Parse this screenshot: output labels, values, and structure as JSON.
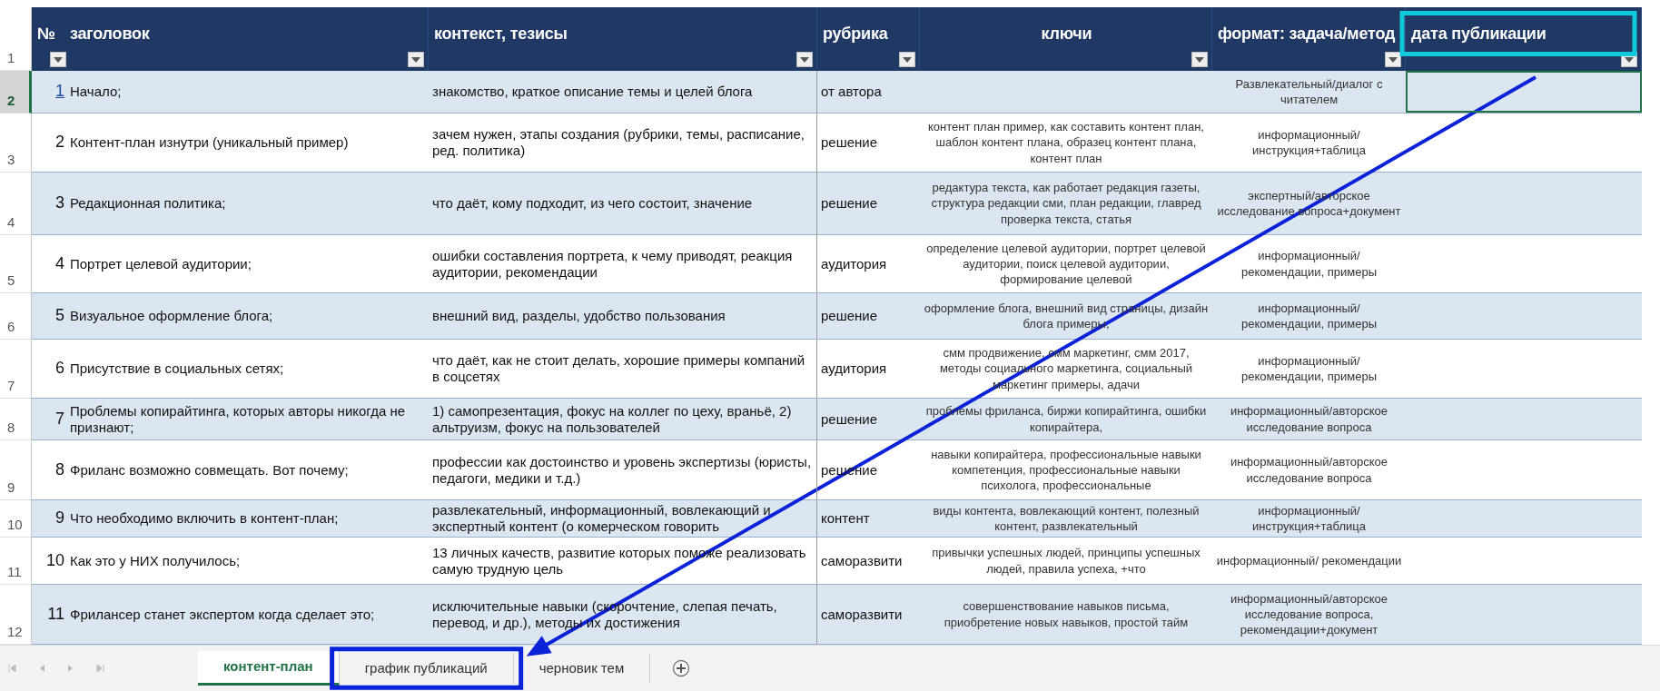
{
  "header": {
    "num_label": "№",
    "columns": [
      {
        "label": "заголовок",
        "highlighted": false
      },
      {
        "label": "контекст, тезисы",
        "highlighted": false
      },
      {
        "label": "рубрика",
        "highlighted": false
      },
      {
        "label": "ключи",
        "highlighted": false
      },
      {
        "label": "формат: задача/метод",
        "highlighted": false
      },
      {
        "label": "дата публикации",
        "highlighted": true
      }
    ]
  },
  "row_numbers": [
    "1",
    "2",
    "3",
    "4",
    "5",
    "6",
    "7",
    "8",
    "9",
    "10",
    "11",
    "12"
  ],
  "rows": [
    {
      "num": "1",
      "link": true,
      "selected": true,
      "title": "Начало;",
      "context": "знакомство, краткое описание темы и целей блога",
      "rubric": "от автора",
      "format": "Развлекательный/диалог с читателем"
    },
    {
      "num": "2",
      "link": false,
      "selected": false,
      "title": "Контент-план изнутри (уникальный пример)",
      "context": "зачем нужен, этапы создания (рубрики, темы, расписание, ред. политика)",
      "rubric": "решение",
      "keys": "контент план пример, как составить контент план, шаблон контент плана, образец контент плана, контент план",
      "format": "информационный/ инструкция+таблица"
    },
    {
      "num": "3",
      "link": false,
      "selected": false,
      "title": "Редакционная политика;",
      "context": "что даёт, кому подходит, из чего состоит, значение",
      "rubric": "решение",
      "keys": "редактура текста, как работает редакция газеты, структура редакции сми, план редакции, главред проверка текста, статья",
      "format": "экспертный/авторское исследование вопроса+документ"
    },
    {
      "num": "4",
      "link": false,
      "selected": false,
      "title": "Портрет целевой аудитории;",
      "context": "ошибки составления портрета, к чему приводят, реакция аудитории, рекомендации",
      "rubric": "аудитория",
      "keys": "определение целевой аудитории, портрет целевой аудитории, поиск целевой аудитории, формирование целевой",
      "format": "информационный/ рекомендации, примеры"
    },
    {
      "num": "5",
      "link": false,
      "selected": false,
      "title": "Визуальное оформление блога;",
      "context": "внешний вид, разделы, удобство пользования",
      "rubric": "решение",
      "keys": "оформление блога, внешний вид страницы, дизайн блога примеры,",
      "format": "информационный/ рекомендации, примеры"
    },
    {
      "num": "6",
      "link": false,
      "selected": false,
      "title": "Присутствие в социальных сетях;",
      "context": "что даёт, как не стоит делать, хорошие примеры компаний в соцсетях",
      "rubric": "аудитория",
      "keys": "смм продвижение, смм маркетинг, смм 2017, методы социального маркетинга, социальный маркетинг примеры, адачи",
      "format": "информационный/ рекомендации, примеры"
    },
    {
      "num": "7",
      "link": false,
      "selected": false,
      "title": "Проблемы копирайтинга, которых авторы никогда не признают;",
      "context": "1) самопрезентация, фокус на коллег по цеху, враньё, 2) альтруизм, фокус на пользователей",
      "rubric": "решение",
      "keys": "проблемы фриланса, биржи копирайтинга, ошибки копирайтера,",
      "format": "информационный/авторское исследование вопроса"
    },
    {
      "num": "8",
      "link": false,
      "selected": false,
      "title": "Фриланс возможно совмещать. Вот почему;",
      "context": "профессии как достоинство и уровень экспертизы (юристы, педагоги, медики и т.д.)",
      "rubric": "решение",
      "keys": "навыки копирайтера, профессиональные навыки компетенция, профессиональные навыки психолога, профессиональные",
      "format": "информационный/авторское исследование вопроса"
    },
    {
      "num": "9",
      "link": false,
      "selected": false,
      "title": "Что необходимо включить в контент-план;",
      "context": "развлекательный, информационный, вовлекающий и экспертный контент (о комерческом говорить",
      "rubric": "контент",
      "keys": "виды контента, вовлекающий контент, полезный контент, развлекательный",
      "format": "информационный/ инструкция+таблица"
    },
    {
      "num": "10",
      "link": false,
      "selected": false,
      "title": "Как это у НИХ получилось;",
      "context": "13 личных качеств, развитие которых поможе реализовать самую трудную цель",
      "rubric": "саморазвити",
      "keys": "привычки успешных людей, принципы успешных людей, правила успеха, +что",
      "format": "информационный/ рекомендации"
    },
    {
      "num": "11",
      "link": false,
      "selected": false,
      "title": "Фрилансер станет экспертом когда сделает это;",
      "context": "исключительные навыки (скорочтение, слепая печать, перевод, и др.), методы их достижения",
      "rubric": "саморазвити",
      "keys": "совершенствование навыков письма, приобретение новых навыков, простой тайм",
      "format": "информационный/авторское исследование вопроса, рекомендации+документ"
    }
  ],
  "sheet_tabs": [
    {
      "label": "контент-план",
      "selected": true,
      "highlighted": false
    },
    {
      "label": "график публикаций",
      "selected": false,
      "highlighted": true
    },
    {
      "label": "черновик тем",
      "selected": false,
      "highlighted": false
    }
  ]
}
